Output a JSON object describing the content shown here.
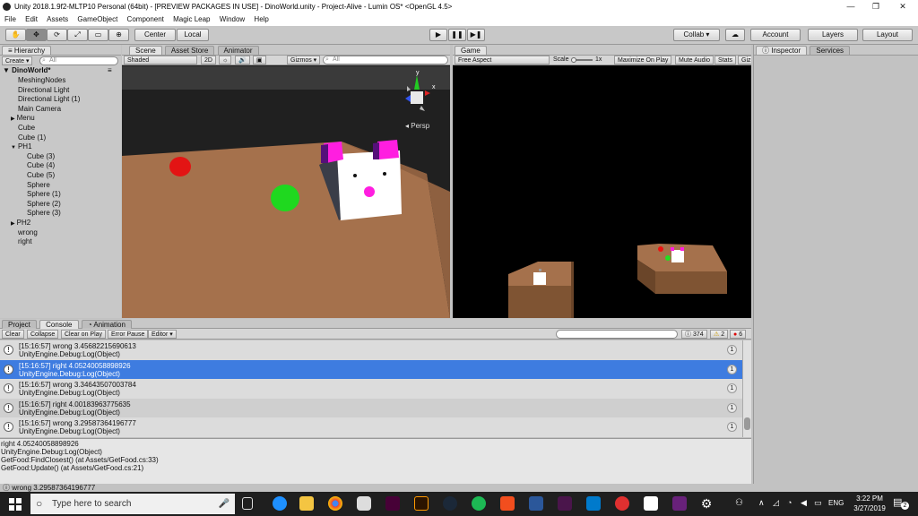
{
  "window": {
    "title": "Unity 2018.1.9f2-MLTP10 Personal (64bit) - [PREVIEW PACKAGES IN USE] - DinoWorld.unity - Project-Alive - Lumin OS* <OpenGL 4.5>",
    "minimize": "—",
    "maximize": "❐",
    "close": "✕"
  },
  "menu": [
    "File",
    "Edit",
    "Assets",
    "GameObject",
    "Component",
    "Magic Leap",
    "Window",
    "Help"
  ],
  "toolbar": {
    "tools": [
      "✋",
      "✥",
      "⟳",
      "⤢",
      "▭",
      "⊕"
    ],
    "pivot": "Center",
    "space": "Local",
    "play": "▶",
    "pause": "❚❚",
    "step": "▶❚",
    "collab": "Collab ▾",
    "cloud": "☁",
    "account": "Account",
    "layers": "Layers",
    "layout": "Layout"
  },
  "hierarchy": {
    "tab": "Hierarchy",
    "create": "Create ▾",
    "search_icon": "search-icon",
    "search_placeholder": "All",
    "scene": "DinoWorld*",
    "items": [
      {
        "label": "MeshingNodes",
        "indent": 1,
        "expand": ""
      },
      {
        "label": "Directional Light",
        "indent": 1,
        "expand": ""
      },
      {
        "label": "Directional Light (1)",
        "indent": 1,
        "expand": ""
      },
      {
        "label": "Main Camera",
        "indent": 1,
        "expand": ""
      },
      {
        "label": "Menu",
        "indent": 1,
        "expand": "▶"
      },
      {
        "label": "Cube",
        "indent": 1,
        "expand": ""
      },
      {
        "label": "Cube (1)",
        "indent": 1,
        "expand": ""
      },
      {
        "label": "PH1",
        "indent": 1,
        "expand": "▼"
      },
      {
        "label": "Cube (3)",
        "indent": 2,
        "expand": ""
      },
      {
        "label": "Cube (4)",
        "indent": 2,
        "expand": ""
      },
      {
        "label": "Cube (5)",
        "indent": 2,
        "expand": ""
      },
      {
        "label": "Sphere",
        "indent": 2,
        "expand": ""
      },
      {
        "label": "Sphere (1)",
        "indent": 2,
        "expand": ""
      },
      {
        "label": "Sphere (2)",
        "indent": 2,
        "expand": ""
      },
      {
        "label": "Sphere (3)",
        "indent": 2,
        "expand": ""
      },
      {
        "label": "PH2",
        "indent": 1,
        "expand": "▶"
      },
      {
        "label": "wrong",
        "indent": 1,
        "expand": ""
      },
      {
        "label": "right",
        "indent": 1,
        "expand": ""
      }
    ]
  },
  "scene": {
    "tabs": [
      "Scene",
      "Asset Store",
      "Animator"
    ],
    "shading": "Shaded",
    "mode_2d": "2D",
    "light": "☼",
    "audio": "🔊",
    "effects": "▣",
    "gizmos": "Gizmos ▾",
    "search_placeholder": "All",
    "persp": "Persp",
    "gizmo_y": "y",
    "gizmo_x": "x"
  },
  "game": {
    "tab": "Game",
    "aspect": "Free Aspect",
    "scale_label": "Scale",
    "scale_value": "1x",
    "maximize": "Maximize On Play",
    "mute": "Mute Audio",
    "stats": "Stats",
    "gizmos": "Giz"
  },
  "inspector": {
    "tabs": [
      "Inspector",
      "Services"
    ]
  },
  "console": {
    "tabs": [
      "Project",
      "Console",
      "Animation"
    ],
    "buttons": [
      "Clear",
      "Collapse",
      "Clear on Play",
      "Error Pause",
      "Editor ▾"
    ],
    "search_placeholder": "",
    "counts": {
      "info": "374",
      "warning": "2",
      "error": "6"
    },
    "rows": [
      {
        "line1": "[15:16:57] wrong 3.45682215690613",
        "line2": "UnityEngine.Debug:Log(Object)",
        "count": "1",
        "selected": false
      },
      {
        "line1": "[15:16:57] right 4.05240058898926",
        "line2": "UnityEngine.Debug:Log(Object)",
        "count": "1",
        "selected": true
      },
      {
        "line1": "[15:16:57] wrong 3.34643507003784",
        "line2": "UnityEngine.Debug:Log(Object)",
        "count": "1",
        "selected": false
      },
      {
        "line1": "[15:16:57] right 4.00183963775635",
        "line2": "UnityEngine.Debug:Log(Object)",
        "count": "1",
        "selected": false
      },
      {
        "line1": "[15:16:57] wrong 3.29587364196777",
        "line2": "UnityEngine.Debug:Log(Object)",
        "count": "1",
        "selected": false
      }
    ],
    "detail": [
      "right 4.05240058898926",
      "UnityEngine.Debug:Log(Object)",
      "GetFood:FindClosest() (at Assets/GetFood.cs:33)",
      "GetFood:Update() (at Assets/GetFood.cs:21)"
    ]
  },
  "status": "wrong 3.29587364196777",
  "taskbar": {
    "search_placeholder": "Type here to search",
    "lang": "ENG",
    "time": "3:22 PM",
    "date": "3/27/2019",
    "notifications": "2"
  },
  "colors": {
    "selection": "#3e7ce0",
    "ground": "#a0704c",
    "magenta": "#ff1ee0",
    "green": "#22dd22",
    "red": "#ee1111"
  }
}
